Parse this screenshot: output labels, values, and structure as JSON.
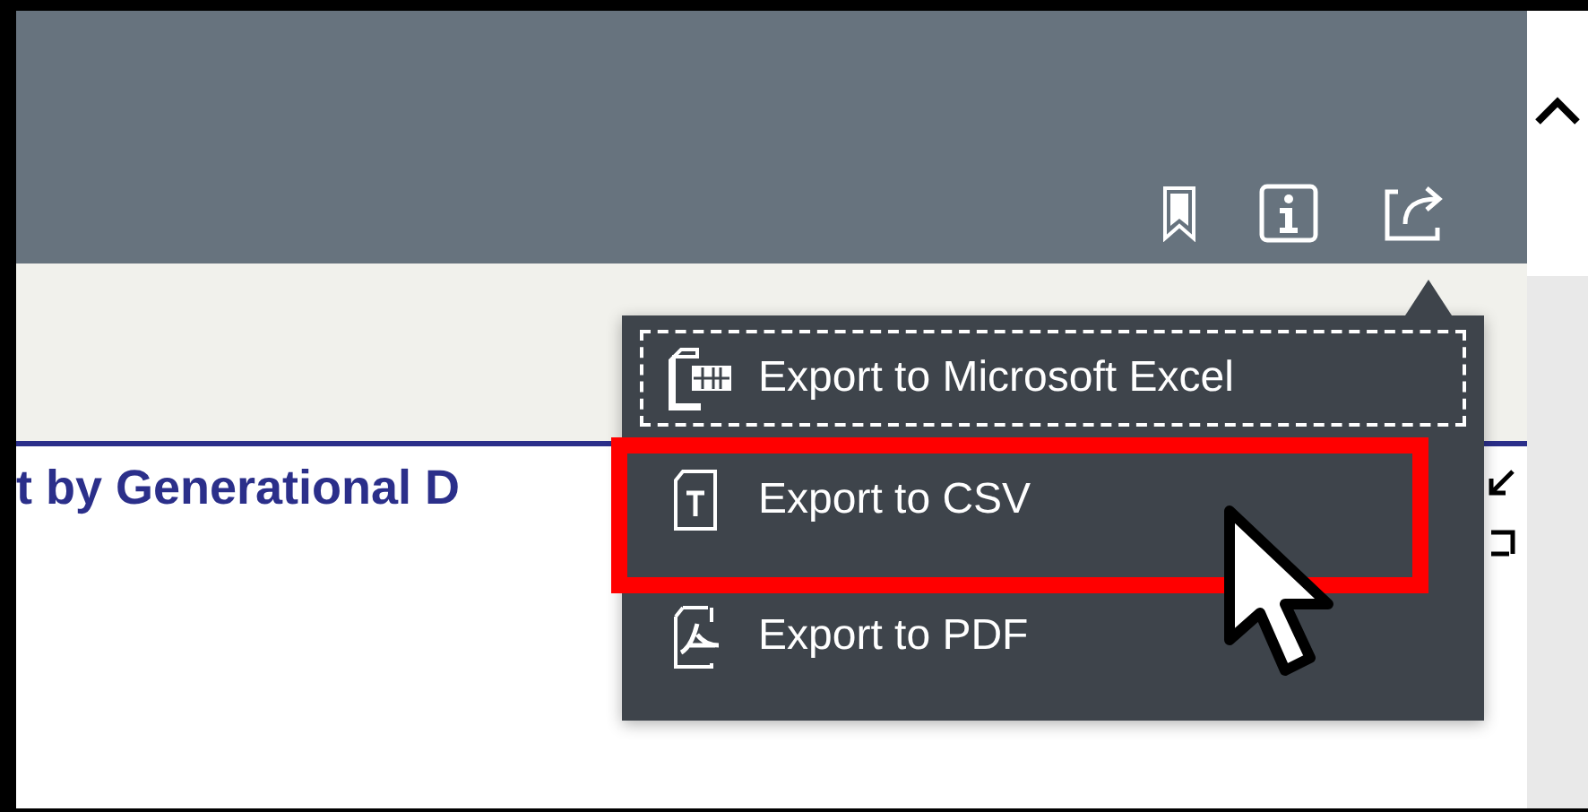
{
  "toolbar": {
    "icons": [
      {
        "kind": "bookmark"
      },
      {
        "kind": "info"
      },
      {
        "kind": "share"
      }
    ]
  },
  "report": {
    "title": "t by Generational D"
  },
  "export_menu": {
    "items": [
      {
        "kind": "excel",
        "label": "Export to Microsoft Excel",
        "focused": true,
        "highlighted": false
      },
      {
        "kind": "csv",
        "label": "Export to CSV",
        "focused": false,
        "highlighted": true
      },
      {
        "kind": "pdf",
        "label": "Export to PDF",
        "focused": false,
        "highlighted": false
      }
    ]
  }
}
